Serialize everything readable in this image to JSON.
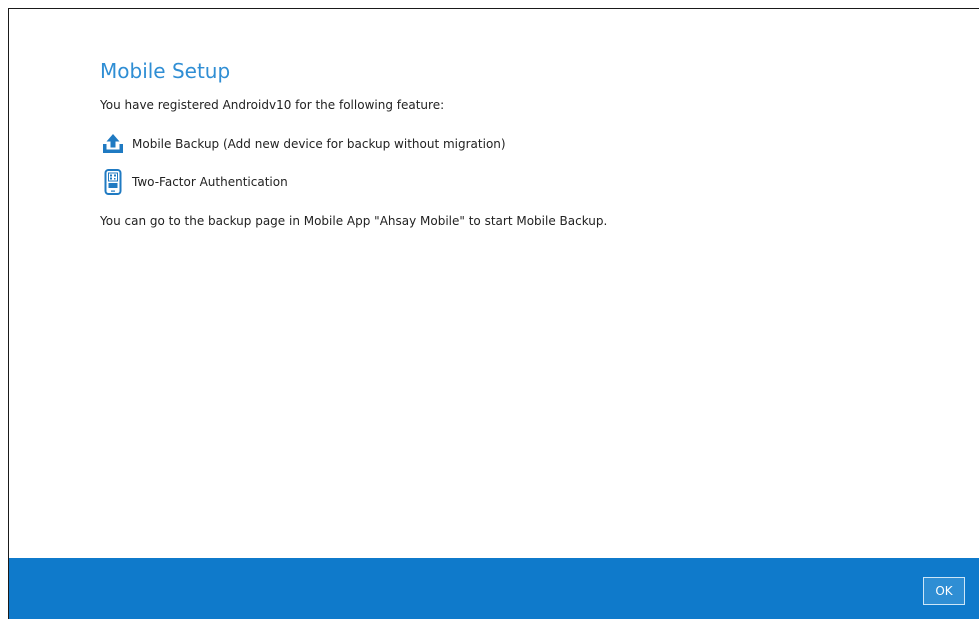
{
  "dialog": {
    "title": "Mobile Setup",
    "description": "You have registered Androidv10 for the following feature:",
    "features": [
      {
        "icon": "upload-icon",
        "label": "Mobile Backup (Add new device for backup without migration)"
      },
      {
        "icon": "two-factor-phone-icon",
        "label": "Two-Factor Authentication"
      }
    ],
    "hint": "You can go to the backup page in Mobile App \"Ahsay Mobile\" to start Mobile Backup.",
    "accent_color": "#2f8ed4",
    "footer_color": "#0f7acb"
  },
  "footer": {
    "ok_label": "OK"
  }
}
